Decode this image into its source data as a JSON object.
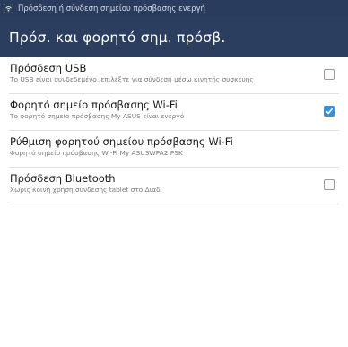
{
  "status_bar": {
    "icon": "wifi-hotspot-icon",
    "notification": "Πρόσδεση ή σύνδεση σημείου πρόσβασης ενεργή"
  },
  "action_bar": {
    "title": "Πρόσ. και φορητό σημ. πρόσβ."
  },
  "settings": [
    {
      "title": "Πρόσδεση USB",
      "summary": "Το USB είναι συνδεδεμένο, επιλέξτε για σύνδεση μέσω κινητής συσκευής",
      "checkbox": true,
      "checked": false
    },
    {
      "title": "Φορητό σημείο πρόσβασης Wi-Fi",
      "summary": "Το φορητό σημείο πρόσβασης My ASUS είναι ενεργό",
      "checkbox": true,
      "checked": true
    },
    {
      "title": "Ρύθμιση φορητού σημείου πρόσβασης Wi-Fi",
      "summary": "Φορητό σημείο πρόσβασης Wi-Fi My ASUSWPA2 PSK",
      "checkbox": false,
      "checked": false
    },
    {
      "title": "Πρόσδεση Bluetooth",
      "summary": "Χωρίς κοινή χρήση σύνδεσης tablet στο Διαδ.",
      "checkbox": true,
      "checked": false
    }
  ],
  "colors": {
    "status_bar": "#2a3c5e",
    "action_bar": "#2c3e60",
    "checkbox_checked": "#3d8fd6"
  }
}
